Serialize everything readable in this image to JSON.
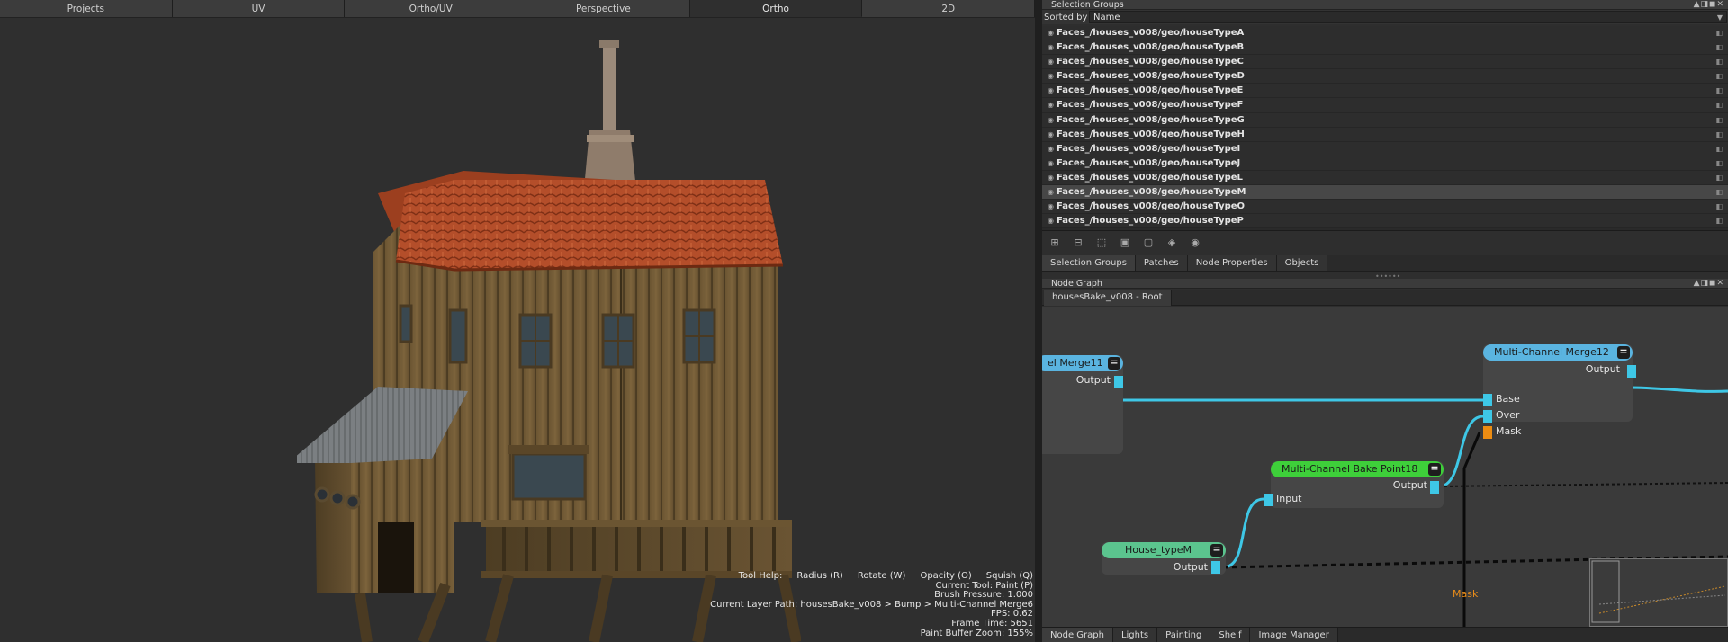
{
  "viewport": {
    "tabs": [
      {
        "label": "Projects",
        "active": false
      },
      {
        "label": "UV",
        "active": false
      },
      {
        "label": "Ortho/UV",
        "active": false
      },
      {
        "label": "Perspective",
        "active": false
      },
      {
        "label": "Ortho",
        "active": true
      },
      {
        "label": "2D",
        "active": false
      }
    ],
    "hud": {
      "tool_help_label": "Tool Help:",
      "tool_help_items": [
        "Radius (R)",
        "Rotate (W)",
        "Opacity (O)",
        "Squish (Q)"
      ],
      "current_tool": "Current Tool: Paint (P)",
      "brush_pressure": "Brush Pressure: 1.000",
      "layer_path": "Current Layer Path: housesBake_v008 > Bump > Multi-Channel Merge6",
      "fps": "FPS: 0.62",
      "frame_time": "Frame Time: 5651",
      "zoom": "Paint Buffer Zoom: 155%"
    }
  },
  "selection_groups": {
    "title": "Selection Groups",
    "window_controls": "▲◨◼✕",
    "sorted_by_label": "Sorted by",
    "sorted_by_value": "Name",
    "items": [
      {
        "label": "Faces_/houses_v008/geo/houseTypeA",
        "selected": false
      },
      {
        "label": "Faces_/houses_v008/geo/houseTypeB",
        "selected": false
      },
      {
        "label": "Faces_/houses_v008/geo/houseTypeC",
        "selected": false
      },
      {
        "label": "Faces_/houses_v008/geo/houseTypeD",
        "selected": false
      },
      {
        "label": "Faces_/houses_v008/geo/houseTypeE",
        "selected": false
      },
      {
        "label": "Faces_/houses_v008/geo/houseTypeF",
        "selected": false
      },
      {
        "label": "Faces_/houses_v008/geo/houseTypeG",
        "selected": false
      },
      {
        "label": "Faces_/houses_v008/geo/houseTypeH",
        "selected": false
      },
      {
        "label": "Faces_/houses_v008/geo/houseTypeI",
        "selected": false
      },
      {
        "label": "Faces_/houses_v008/geo/houseTypeJ",
        "selected": false
      },
      {
        "label": "Faces_/houses_v008/geo/houseTypeL",
        "selected": false
      },
      {
        "label": "Faces_/houses_v008/geo/houseTypeM",
        "selected": true
      },
      {
        "label": "Faces_/houses_v008/geo/houseTypeO",
        "selected": false
      },
      {
        "label": "Faces_/houses_v008/geo/houseTypeP",
        "selected": false
      }
    ],
    "toolbar_icons": [
      "add-group-icon",
      "remove-group-icon",
      "select-icon",
      "lock-icon",
      "unlock-icon",
      "layers-icon",
      "eye-icon"
    ],
    "tabs": [
      {
        "label": "Selection Groups",
        "active": true
      },
      {
        "label": "Patches",
        "active": false
      },
      {
        "label": "Node Properties",
        "active": false
      },
      {
        "label": "Objects",
        "active": false
      }
    ]
  },
  "node_graph": {
    "title": "Node Graph",
    "window_controls": "▲◨◼✕",
    "root_tab": "housesBake_v008 - Root",
    "nodes": {
      "merge11": {
        "title": "el Merge11",
        "output": "Output",
        "color": "#5ab4e0"
      },
      "merge12": {
        "title": "Multi-Channel Merge12",
        "output": "Output",
        "inputs": [
          "Base",
          "Over",
          "Mask"
        ],
        "color": "#5ab4e0"
      },
      "bake18": {
        "title": "Multi-Channel Bake Point18",
        "output": "Output",
        "inputs": [
          "Input"
        ],
        "color": "#3ecf3a"
      },
      "house": {
        "title": "House_typeM",
        "output": "Output",
        "color": "#5bc48e"
      }
    },
    "connection_label": "Mask",
    "colors": {
      "wire_cyan": "#3ec7e6",
      "mask_orange": "#ec8c12",
      "wire_black": "#0a0a0a"
    }
  },
  "bottom_tabs": [
    {
      "label": "Node Graph",
      "active": true
    },
    {
      "label": "Lights",
      "active": false
    },
    {
      "label": "Painting",
      "active": false
    },
    {
      "label": "Shelf",
      "active": false
    },
    {
      "label": "Image Manager",
      "active": false
    }
  ]
}
